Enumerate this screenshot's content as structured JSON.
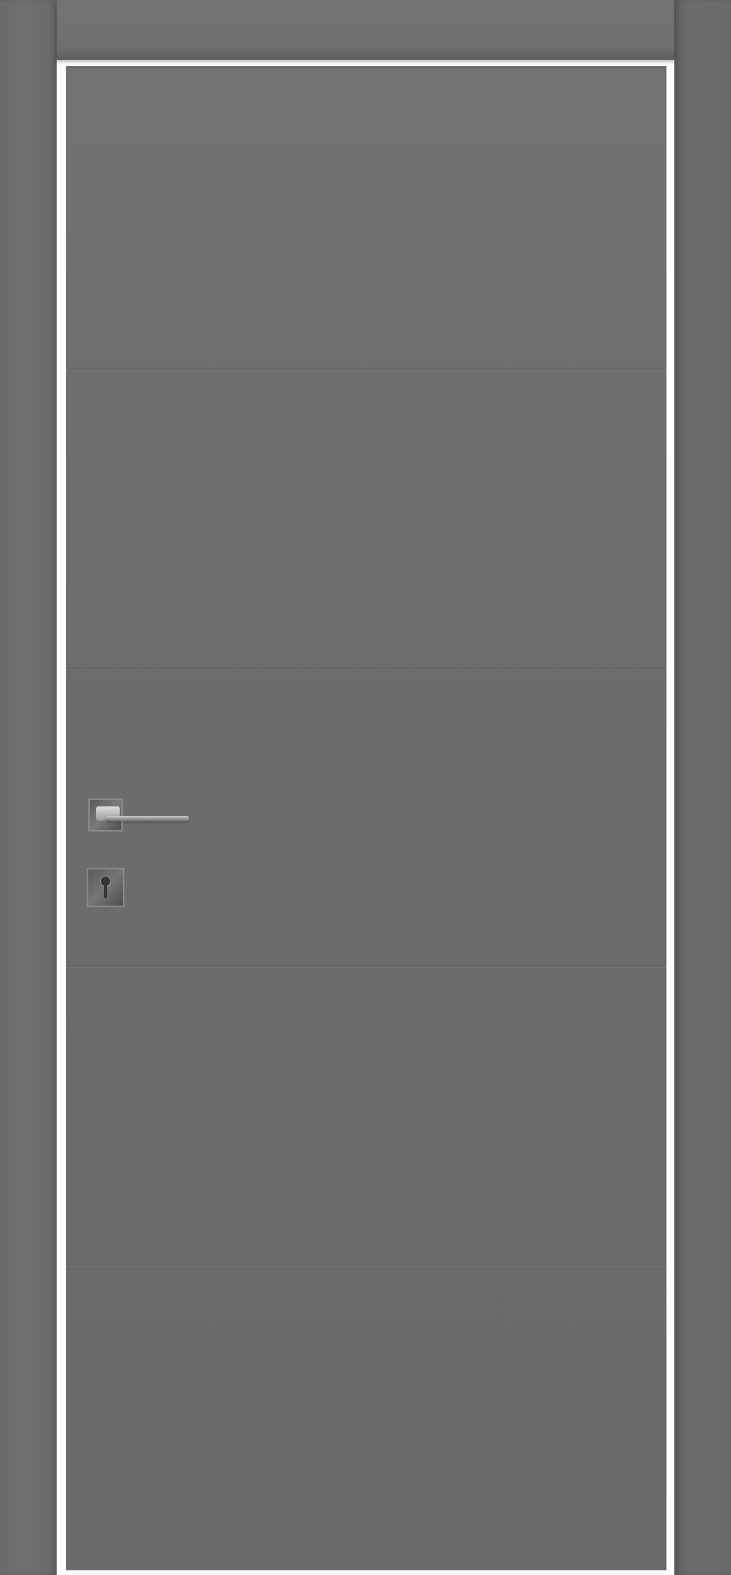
{
  "scene": {
    "subject": "door",
    "finish_color": "#6c6c6c",
    "frame_color": "#6d6d6d",
    "groove_count": 4,
    "hardware": {
      "handle": "lever-handle-icon",
      "lock": "keyhole-icon",
      "hardware_color": "#9a9a9a"
    }
  }
}
